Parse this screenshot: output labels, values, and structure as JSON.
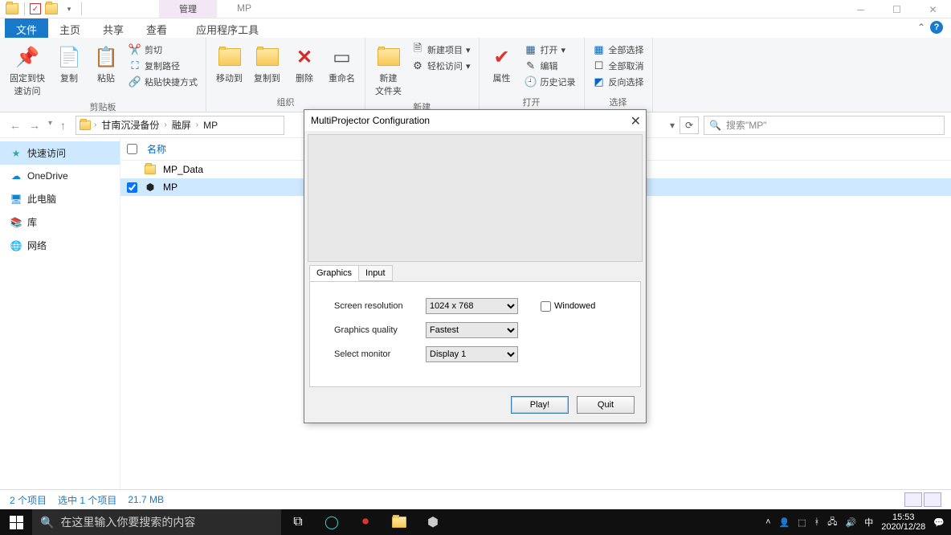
{
  "titlebar": {
    "context_tab": "管理",
    "app_title": "MP"
  },
  "tabs": {
    "file": "文件",
    "home": "主页",
    "share": "共享",
    "view": "查看",
    "apptools": "应用程序工具"
  },
  "ribbon": {
    "clipboard": {
      "pin": "固定到快\n速访问",
      "copy": "复制",
      "paste": "粘贴",
      "cut": "剪切",
      "copypath": "复制路径",
      "pasteshortcut": "粘贴快捷方式",
      "label": "剪贴板"
    },
    "organize": {
      "moveto": "移动到",
      "copyto": "复制到",
      "delete": "删除",
      "rename": "重命名",
      "label": "组织"
    },
    "new": {
      "newfolder": "新建\n文件夹",
      "newitem": "新建项目",
      "easyaccess": "轻松访问",
      "label": "新建"
    },
    "open": {
      "properties": "属性",
      "open": "打开",
      "edit": "编辑",
      "history": "历史记录",
      "label": "打开"
    },
    "select": {
      "selectall": "全部选择",
      "selectnone": "全部取消",
      "invert": "反向选择",
      "label": "选择"
    }
  },
  "breadcrumb": {
    "a": "甘南沉浸备份",
    "b": "融屏",
    "c": "MP"
  },
  "search": {
    "placeholder": "搜索\"MP\""
  },
  "sidebar": {
    "quick": "快速访问",
    "onedrive": "OneDrive",
    "thispc": "此电脑",
    "libraries": "库",
    "network": "网络"
  },
  "columns": {
    "name": "名称"
  },
  "files": {
    "r0": "MP_Data",
    "r1": "MP"
  },
  "status": {
    "count": "2 个项目",
    "selected": "选中 1 个项目",
    "size": "21.7 MB"
  },
  "dialog": {
    "title": "MultiProjector Configuration",
    "tab_graphics": "Graphics",
    "tab_input": "Input",
    "lbl_res": "Screen resolution",
    "lbl_qual": "Graphics quality",
    "lbl_mon": "Select monitor",
    "opt_res": "1024 x 768",
    "opt_qual": "Fastest",
    "opt_mon": "Display 1",
    "chk_windowed": "Windowed",
    "btn_play": "Play!",
    "btn_quit": "Quit"
  },
  "taskbar": {
    "search": "在这里输入你要搜索的内容",
    "ime": "中",
    "time": "15:53",
    "date": "2020/12/28"
  }
}
